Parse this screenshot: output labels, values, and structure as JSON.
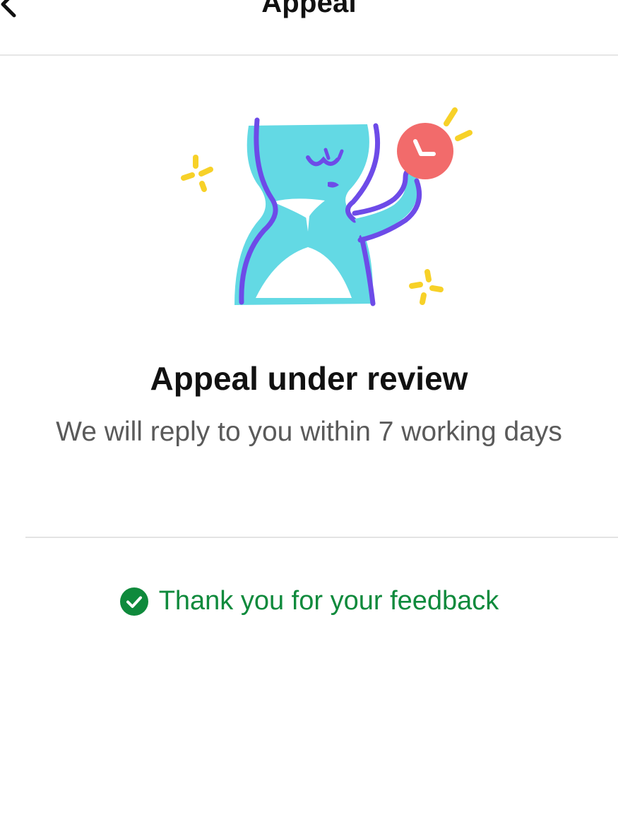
{
  "header": {
    "title": "Appeal",
    "back_icon": "chevron-left-icon"
  },
  "illustration": {
    "name": "hourglass-character-illustration",
    "colors": {
      "body": "#63D9E4",
      "outline": "#6D4BE8",
      "clock": "#F26B6B",
      "sparkle": "#F7D128"
    }
  },
  "status": {
    "title": "Appeal under review",
    "subtitle": "We will reply to you within 7 working days"
  },
  "feedback": {
    "icon": "check-circle-icon",
    "text": "Thank you for your feedback",
    "color": "#0F8A3C"
  }
}
